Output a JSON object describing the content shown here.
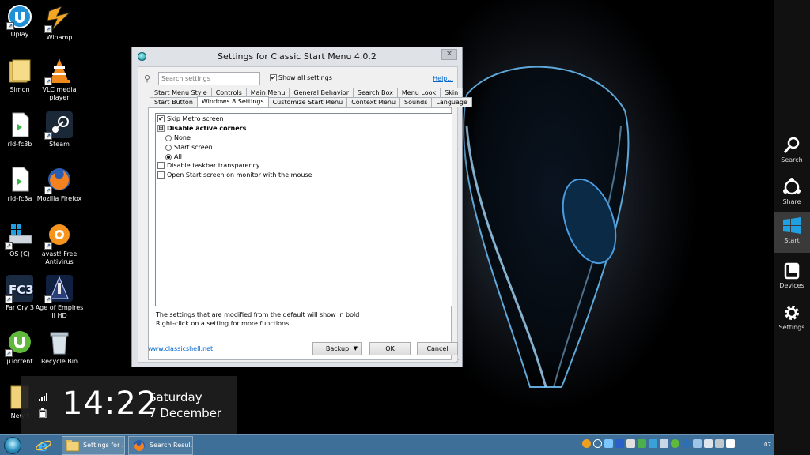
{
  "desktop": {
    "icons": [
      {
        "label": "Uplay",
        "icon": "uplay-icon"
      },
      {
        "label": "Winamp",
        "icon": "winamp-icon"
      },
      {
        "label": "Simon",
        "icon": "folder-icon"
      },
      {
        "label": "VLC media player",
        "icon": "vlc-icon"
      },
      {
        "label": "rld-fc3b",
        "icon": "file-icon"
      },
      {
        "label": "Steam",
        "icon": "steam-icon"
      },
      {
        "label": "rld-fc3a",
        "icon": "file-icon"
      },
      {
        "label": "Mozilla Firefox",
        "icon": "firefox-icon"
      },
      {
        "label": "OS (C)",
        "icon": "drive-icon"
      },
      {
        "label": "avast! Free Antivirus",
        "icon": "avast-icon"
      },
      {
        "label": "Far Cry 3",
        "icon": "farcry3-icon"
      },
      {
        "label": "Age of Empires II HD",
        "icon": "aoe2-icon"
      },
      {
        "label": "µTorrent",
        "icon": "utorrent-icon"
      },
      {
        "label": "Recycle Bin",
        "icon": "recycle-bin-icon"
      },
      {
        "label": "New f",
        "icon": "folder-icon"
      }
    ]
  },
  "dialog": {
    "title": "Settings for Classic Start Menu 4.0.2",
    "close_label": "✕",
    "search_placeholder": "Search settings",
    "show_all_label": "Show all settings",
    "show_all_checked": true,
    "help_label": "Help...",
    "tabs_row1": [
      "Start Menu Style",
      "Controls",
      "Main Menu",
      "General Behavior",
      "Search Box",
      "Menu Look",
      "Skin"
    ],
    "tabs_row2": [
      "Start Button",
      "Windows 8 Settings",
      "Customize Start Menu",
      "Context Menu",
      "Sounds",
      "Language"
    ],
    "active_tab": "Windows 8 Settings",
    "settings": [
      {
        "type": "checkbox",
        "label": "Skip Metro screen",
        "checked": true,
        "bold": false
      },
      {
        "type": "group",
        "label": "Disable active corners",
        "bold": true
      },
      {
        "type": "radio",
        "label": "None",
        "checked": false
      },
      {
        "type": "radio",
        "label": "Start screen",
        "checked": false
      },
      {
        "type": "radio",
        "label": "All",
        "checked": true
      },
      {
        "type": "checkbox",
        "label": "Disable taskbar transparency",
        "checked": false,
        "bold": false
      },
      {
        "type": "checkbox",
        "label": "Open Start screen on monitor with the mouse",
        "checked": false,
        "bold": false
      }
    ],
    "footnote_1": "The settings that are modified from the default will show in bold",
    "footnote_2": "Right-click on a setting for more functions",
    "site_link": "www.classicshell.net",
    "backup_label": "Backup",
    "ok_label": "OK",
    "cancel_label": "Cancel"
  },
  "clock": {
    "time": "14:22",
    "day": "Saturday",
    "date": "7 December"
  },
  "charms": [
    {
      "label": "Search",
      "icon": "search-icon"
    },
    {
      "label": "Share",
      "icon": "share-icon"
    },
    {
      "label": "Start",
      "icon": "windows-logo-icon"
    },
    {
      "label": "Devices",
      "icon": "devices-icon"
    },
    {
      "label": "Settings",
      "icon": "gear-icon"
    }
  ],
  "taskbar": {
    "items": [
      {
        "label": "Settings for ...",
        "icon": "folder-icon"
      },
      {
        "label": "Search Resul...",
        "icon": "firefox-icon"
      }
    ],
    "tray_clock": "07"
  },
  "colors": {
    "taskbar": "#3d6f98",
    "link": "#0066cc",
    "charms_bg": "#111111"
  }
}
